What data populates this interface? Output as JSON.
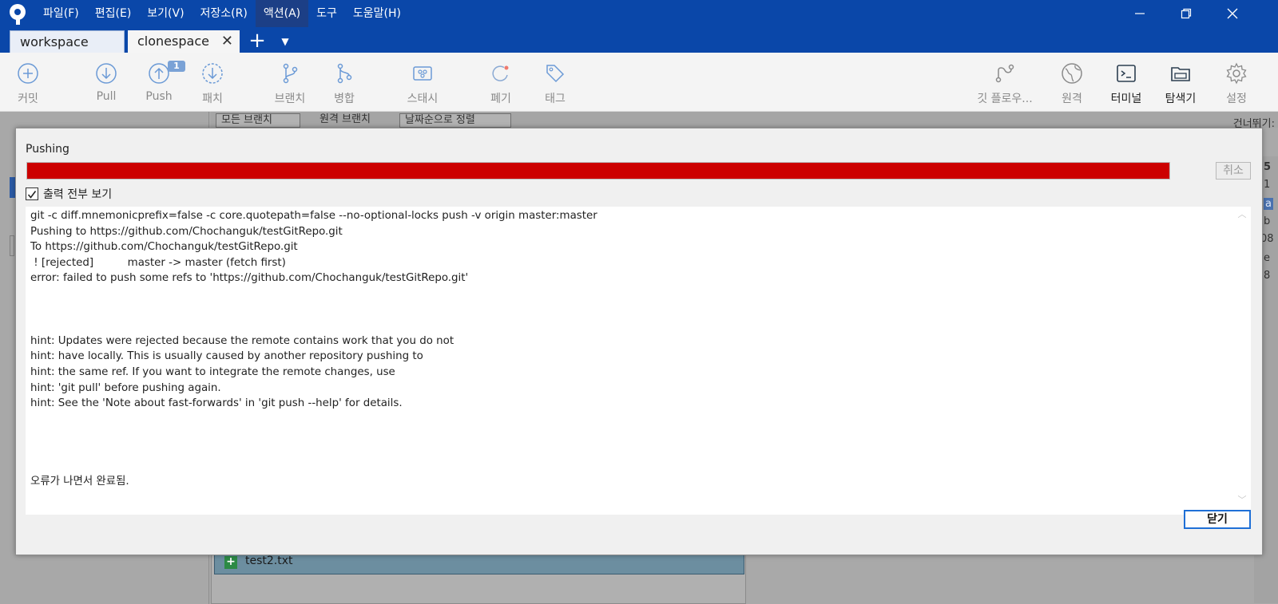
{
  "menu": [
    "파일(F)",
    "편집(E)",
    "보기(V)",
    "저장소(R)",
    "액션(A)",
    "도구",
    "도움말(H)"
  ],
  "tabs": {
    "workspace": "workspace",
    "clonespace": "clonespace"
  },
  "toolbar": {
    "commit": "커밋",
    "pull": "Pull",
    "push": "Push",
    "push_badge": "1",
    "patch": "패치",
    "branch": "브랜치",
    "merge": "병합",
    "stash": "스태시",
    "discard": "폐기",
    "tag": "태그",
    "gitflow": "깃 플로우...",
    "remote": "원격",
    "terminal": "터미널",
    "explorer": "탐색기",
    "settings": "설정"
  },
  "background": {
    "branch_filter": "모든 브랜치",
    "remote_branches": "원격 브랜치",
    "sort": "날짜순으로 정렬",
    "skip": "건너뛰기:",
    "right_chars": [
      "5",
      "1",
      "a",
      "b",
      "08",
      "e",
      "8"
    ],
    "file_name": "test2.txt"
  },
  "dialog": {
    "title": "Pushing",
    "progress": 1.0,
    "cancel_label": "취소",
    "show_all_label": "출력 전부 보기",
    "show_all_checked": true,
    "output": "git -c diff.mnemonicprefix=false -c core.quotepath=false --no-optional-locks push -v origin master:master\nPushing to https://github.com/Chochanguk/testGitRepo.git\nTo https://github.com/Chochanguk/testGitRepo.git\n ! [rejected]          master -> master (fetch first)\nerror: failed to push some refs to 'https://github.com/Chochanguk/testGitRepo.git'\n\n\n\nhint: Updates were rejected because the remote contains work that you do not\nhint: have locally. This is usually caused by another repository pushing to\nhint: the same ref. If you want to integrate the remote changes, use\nhint: 'git pull' before pushing again.\nhint: See the 'Note about fast-forwards' in 'git push --help' for details.\n\n\n\n\n오류가 나면서 완료됨.",
    "close_label": "닫기"
  },
  "colors": {
    "titlebar": "#0a47a9",
    "progress_fill": "#cc0000",
    "accent": "#1e6fd6"
  }
}
